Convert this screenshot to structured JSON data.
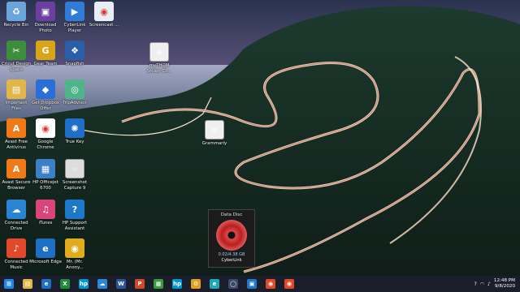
{
  "desktop": {
    "icons": [
      {
        "label": "Recycle Bin",
        "color": "#6aa4d8",
        "glyph": "♻"
      },
      {
        "label": "Download Photo",
        "color": "#6a3fa0",
        "glyph": "▣"
      },
      {
        "label": "CyberLink Player",
        "color": "#2f7bd6",
        "glyph": "▶"
      },
      {
        "label": "Screencast ...",
        "color": "#e9eef6",
        "glyph": "◉"
      },
      {
        "label": "Cricut Design Space",
        "color": "#3c8d3c",
        "glyph": "✂"
      },
      {
        "label": "Gear Team",
        "color": "#d8a41a",
        "glyph": "G"
      },
      {
        "label": "Snapfish",
        "color": "#2a5ea8",
        "glyph": "❖"
      },
      {
        "label": "Important Files",
        "color": "#e0b54a",
        "glyph": "▤"
      },
      {
        "label": "Get Dropbox Offer",
        "color": "#2b6fd6",
        "glyph": "◆"
      },
      {
        "label": "TripAdvisor",
        "color": "#4fb48a",
        "glyph": "◎"
      },
      {
        "label": "Avast Free Antivirus",
        "color": "#f07a18",
        "glyph": "A"
      },
      {
        "label": "Google Chrome",
        "color": "#ffffff",
        "glyph": "◉"
      },
      {
        "label": "True Key",
        "color": "#1f6fc8",
        "glyph": "✺"
      },
      {
        "label": "Avast Secure Browser",
        "color": "#f07a18",
        "glyph": "A"
      },
      {
        "label": "HP Officejet 6700",
        "color": "#3a7fc8",
        "glyph": "▦"
      },
      {
        "label": "Screenshot Capture 9",
        "color": "#dddddd",
        "glyph": "▭"
      },
      {
        "label": "Connected Drive",
        "color": "#2a84d0",
        "glyph": "☁"
      },
      {
        "label": "iTunes",
        "color": "#d8457a",
        "glyph": "♫"
      },
      {
        "label": "HP Support Assistant",
        "color": "#1c78c8",
        "glyph": "?"
      },
      {
        "label": "Connected Music",
        "color": "#e04a2a",
        "glyph": "♪"
      },
      {
        "label": "Microsoft Edge",
        "color": "#1d6fc4",
        "glyph": "e"
      },
      {
        "label": "Mr. (Mr. Anony...",
        "color": "#e0ac1c",
        "glyph": "◉"
      },
      {
        "label": "Grammarly",
        "color": "#f0f0f0",
        "glyph": "▤"
      },
      {
        "label": "myTHOM Stolen Cli...",
        "color": "#f0f0f0",
        "glyph": "▤"
      }
    ]
  },
  "popup": {
    "title": "Data Disc",
    "capacity": "0.02/4.38 GB",
    "brand": "CyberLink"
  },
  "taskbar": {
    "items": [
      {
        "name": "start",
        "color": "#1e88e5",
        "glyph": "⊞"
      },
      {
        "name": "file-explorer",
        "color": "#e0b54a",
        "glyph": "▤"
      },
      {
        "name": "edge",
        "color": "#1d6fc4",
        "glyph": "e"
      },
      {
        "name": "xbox",
        "color": "#1e8c3a",
        "glyph": "X"
      },
      {
        "name": "hp",
        "color": "#0096d6",
        "glyph": "hp"
      },
      {
        "name": "onedrive",
        "color": "#2b88d8",
        "glyph": "☁"
      },
      {
        "name": "word",
        "color": "#2b5797",
        "glyph": "W"
      },
      {
        "name": "powerpoint",
        "color": "#d24726",
        "glyph": "P"
      },
      {
        "name": "calculator",
        "color": "#3c9a3c",
        "glyph": "▦"
      },
      {
        "name": "hp-smart",
        "color": "#0096d6",
        "glyph": "hp"
      },
      {
        "name": "settings",
        "color": "#e0a020",
        "glyph": "⚙"
      },
      {
        "name": "edge-new",
        "color": "#1fa6b8",
        "glyph": "e"
      },
      {
        "name": "cortana",
        "color": "#3a4a6a",
        "glyph": "◯"
      },
      {
        "name": "photos",
        "color": "#1e78c8",
        "glyph": "▣"
      },
      {
        "name": "chrome-1",
        "color": "#e04a2a",
        "glyph": "◉"
      },
      {
        "name": "chrome-2",
        "color": "#e04a2a",
        "glyph": "◉"
      }
    ]
  },
  "tray": {
    "time": "12:48 PM",
    "date": "9/8/2020"
  }
}
